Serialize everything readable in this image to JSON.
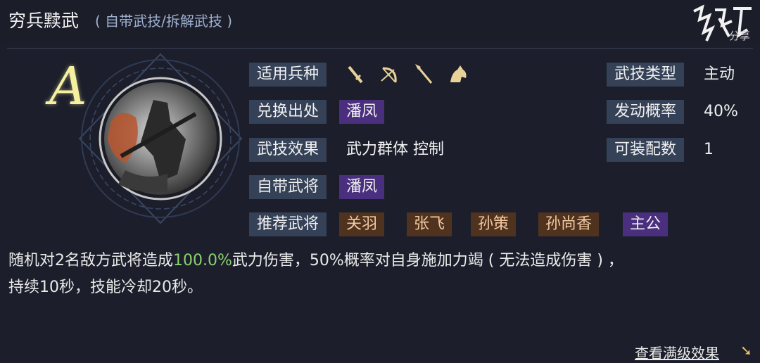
{
  "header": {
    "title": "穷兵黩武",
    "subtitle": "( 自带武技/拆解武技 )",
    "logo_text": "分享"
  },
  "grade": "A",
  "troops_icons": [
    "sword-icon",
    "bow-icon",
    "spear-icon",
    "horse-icon"
  ],
  "left_labels": {
    "troops": "适用兵种",
    "source": "兑换出处",
    "effect": "武技效果",
    "own_general": "自带武将",
    "recommend": "推荐武将"
  },
  "source_tag": "潘凤",
  "effect_value": "武力群体 控制",
  "own_general_tag": "潘凤",
  "recommend_tags": [
    "关羽",
    "张飞",
    "孙策",
    "孙尚香",
    "主公"
  ],
  "right_labels": {
    "type": "武技类型",
    "rate": "发动概率",
    "cost": "可装配数"
  },
  "right_values": {
    "type": "主动",
    "rate": "40%",
    "cost": "1"
  },
  "description": {
    "part1": "随机对2名敌方武将造成",
    "highlight": "100.0%",
    "part2": "武力伤害，50%概率对自身施加力竭 ( 无法造成伤害 ) ，",
    "line2": "持续10秒，技能冷却20秒。"
  },
  "bottom_link": "查看满级效果",
  "colors": {
    "background": "#1c1f2b",
    "label_bg": "#344157",
    "purple_tag": "#4a2f7e",
    "orange_tag": "#50331e",
    "highlight_green": "#8bd06f",
    "grade_yellow": "#f4f0a0"
  }
}
